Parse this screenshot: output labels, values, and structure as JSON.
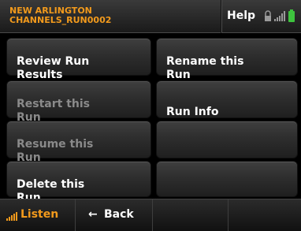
{
  "header": {
    "title_line1": "NEW ARLINGTON",
    "title_line2": "CHANNELS_RUN0002",
    "help_label": "Help",
    "status_icons": [
      "lock-icon",
      "signal-bars-icon",
      "battery-icon"
    ]
  },
  "menu": {
    "review_results": "Review Run\nResults",
    "rename_run": "Rename this\nRun",
    "restart_run": "Restart this\nRun",
    "run_info": "Run Info",
    "resume_run": "Resume this\nRun",
    "delete_run": "Delete this\nRun"
  },
  "footer": {
    "listen_label": "Listen",
    "back_arrow": "←",
    "back_label": "Back"
  },
  "colors": {
    "accent": "#f29a1c",
    "battery": "#3ec43e",
    "disabled_text": "#8a8a8a"
  }
}
